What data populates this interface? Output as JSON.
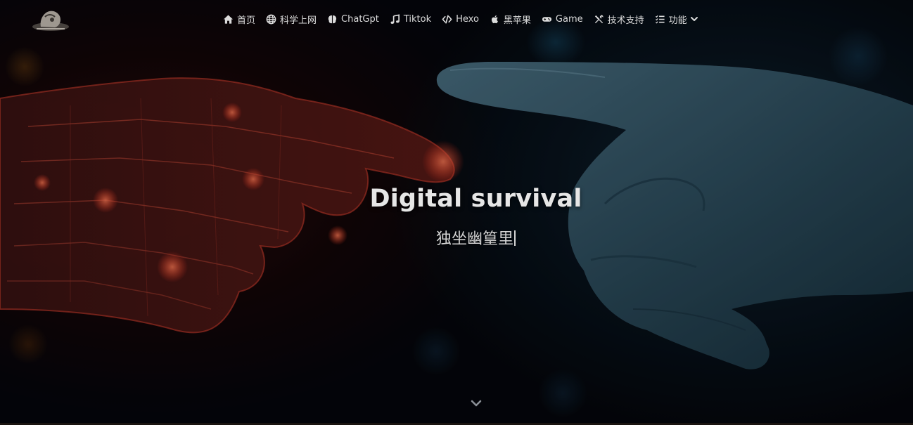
{
  "nav": {
    "items": [
      {
        "label": "首页",
        "icon": "home-icon"
      },
      {
        "label": "科学上网",
        "icon": "globe-icon"
      },
      {
        "label": "ChatGpt",
        "icon": "brain-icon"
      },
      {
        "label": "Tiktok",
        "icon": "music-icon"
      },
      {
        "label": "Hexo",
        "icon": "code-icon"
      },
      {
        "label": "黑苹果",
        "icon": "apple-icon"
      },
      {
        "label": "Game",
        "icon": "gamepad-icon"
      },
      {
        "label": "技术支持",
        "icon": "tools-icon"
      },
      {
        "label": "功能",
        "icon": "list-icon"
      }
    ]
  },
  "hero": {
    "title": "Digital survival",
    "subtitle": "独坐幽篁里"
  },
  "colors": {
    "background": "#05070c",
    "text": "#e6e6e6",
    "robot_glow": "#e0452f",
    "human_hand": "#3e6478"
  }
}
